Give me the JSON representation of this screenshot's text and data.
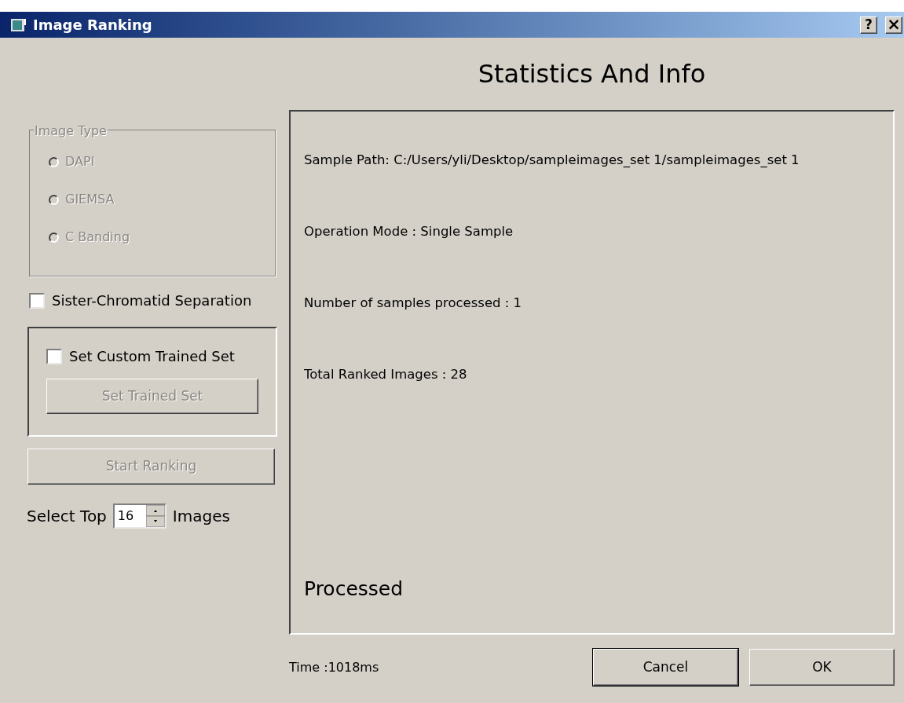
{
  "window": {
    "title": "Image Ranking",
    "buttons": [
      {
        "kind": "help",
        "label": "?"
      },
      {
        "kind": "close",
        "label": "×"
      }
    ]
  },
  "heading": "Statistics And Info",
  "image_type": {
    "title": "Image Type",
    "disabled": true,
    "options": [
      {
        "label": "DAPI",
        "selected": false
      },
      {
        "label": "GIEMSA",
        "selected": false
      },
      {
        "label": "C Banding",
        "selected": false
      }
    ]
  },
  "sister_chromatid": {
    "label": "Sister-Chromatid Separation",
    "checked": false
  },
  "custom_set": {
    "label": "Set Custom Trained Set",
    "checked": false,
    "button": {
      "label": "Set Trained Set",
      "disabled": true
    }
  },
  "start_button": {
    "label": "Start Ranking",
    "disabled": true
  },
  "select_top": {
    "prefix": "Select Top",
    "value": "16",
    "suffix": "Images"
  },
  "info_lines": [
    "Sample Path: C:/Users/yli/Desktop/sampleimages_set 1/sampleimages_set 1",
    "Operation Mode : Single Sample",
    "Number of samples processed : 1",
    "Total Ranked Images : 28"
  ],
  "status": "Processed",
  "time": "Time :1018ms",
  "buttons": [
    {
      "label": "Cancel",
      "default": true
    },
    {
      "label": "OK",
      "default": false
    }
  ]
}
